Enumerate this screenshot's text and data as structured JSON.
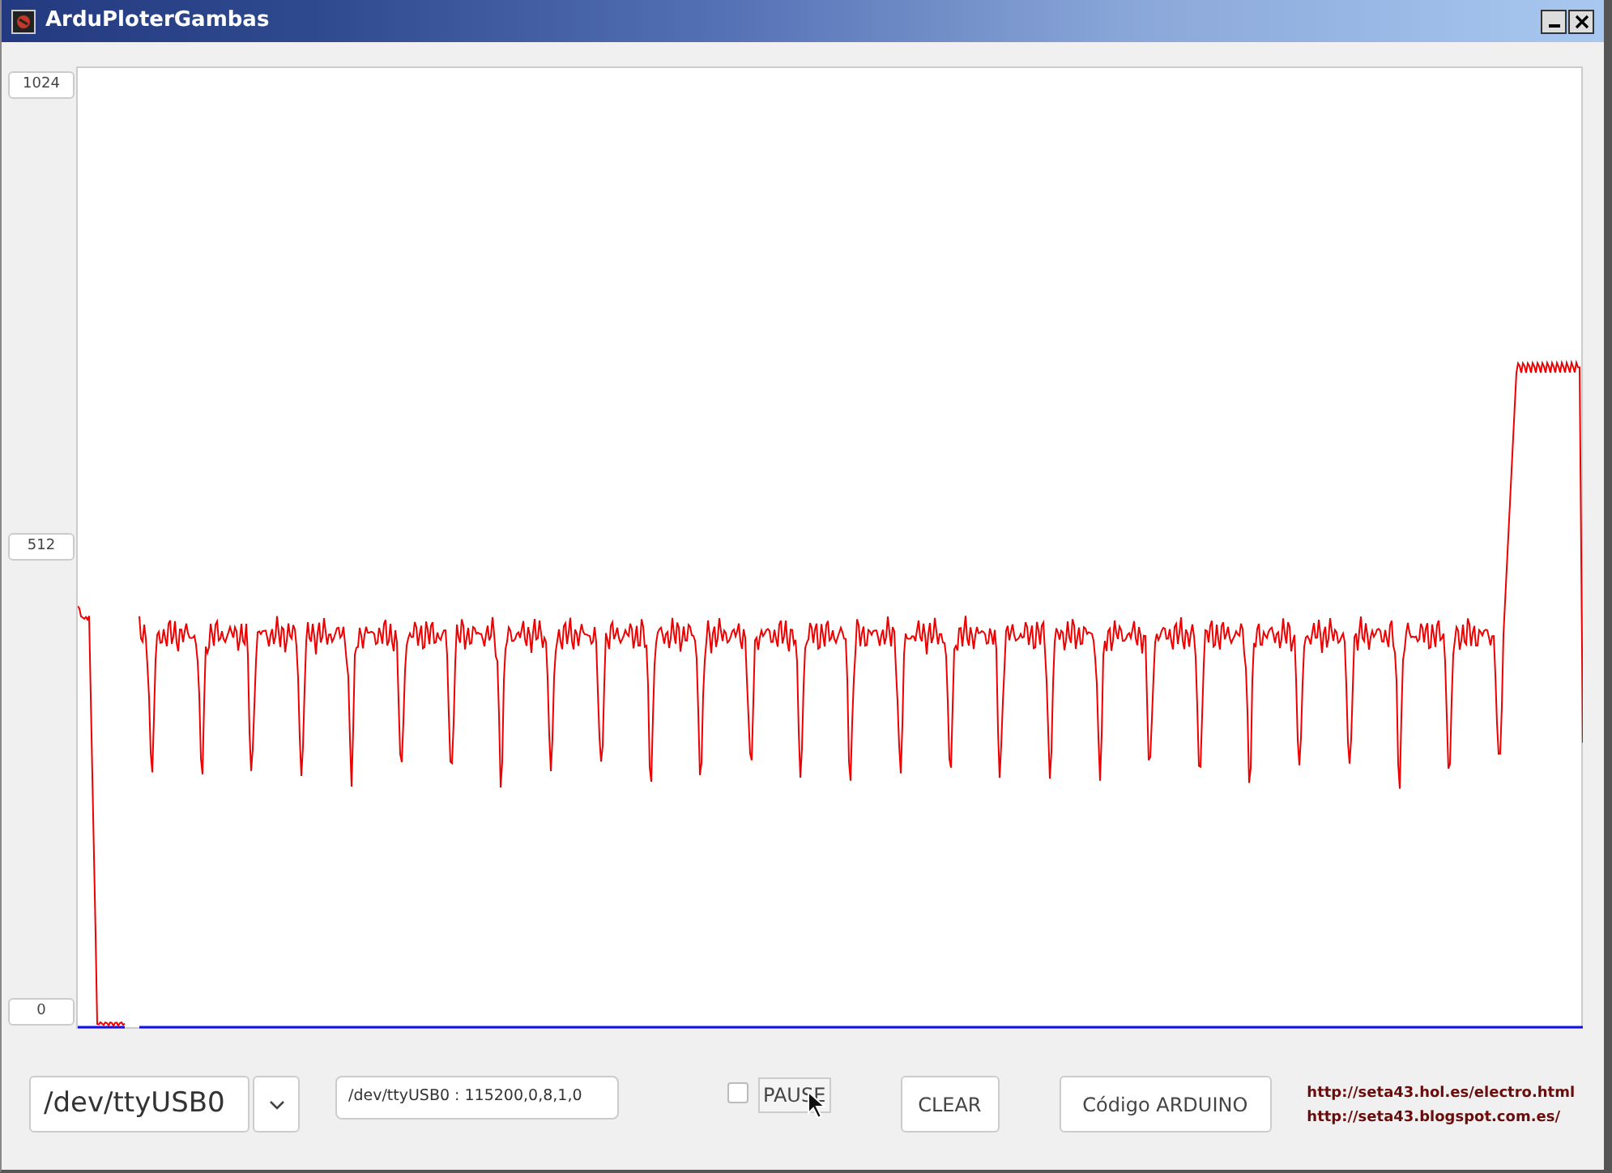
{
  "window": {
    "title": "ArduPloterGambas"
  },
  "scale_labels": [
    "1024",
    "512",
    "0"
  ],
  "port_combo": {
    "value": "/dev/ttyUSB0"
  },
  "settings_field": {
    "value": "/dev/ttyUSB0 : 115200,0,8,1,0"
  },
  "pause": {
    "label": "PAUSE",
    "checked": false
  },
  "buttons": [
    "CLEAR",
    "Código ARDUINO"
  ],
  "links": [
    "http://seta43.hol.es/electro.html",
    "http://seta43.blogspot.com.es/"
  ]
}
